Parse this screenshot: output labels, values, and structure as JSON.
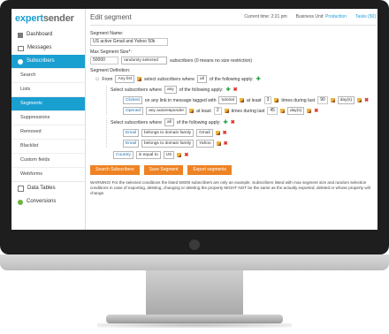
{
  "app": {
    "logo_left": "expert",
    "logo_right": "sender"
  },
  "nav": {
    "main": [
      {
        "label": "Dashboard",
        "active": false
      },
      {
        "label": "Messages",
        "active": false
      },
      {
        "label": "Subscribers",
        "active": true
      }
    ],
    "sub": [
      {
        "label": "Search",
        "active": false
      },
      {
        "label": "Lists",
        "active": false
      },
      {
        "label": "Segments",
        "active": true
      },
      {
        "label": "Suppressions",
        "active": false
      },
      {
        "label": "Removed",
        "active": false
      },
      {
        "label": "Blacklist",
        "active": false
      },
      {
        "label": "Custom fields",
        "active": false
      },
      {
        "label": "Webforms",
        "active": false
      }
    ],
    "bottom": [
      {
        "label": "Data Tables"
      },
      {
        "label": "Conversions"
      }
    ]
  },
  "header": {
    "title": "Edit segment",
    "time_label": "Current time: 2:21 pm",
    "business_label": "Business Unit:",
    "business_value": "Production",
    "tasks": "Tasks (50)"
  },
  "form": {
    "name_label": "Segment Name:",
    "name_value": "US active Gmail and Yahoo 50k",
    "max_label": "Max Segment Size*:",
    "max_value": "50000",
    "max_mode": "randomly selected",
    "max_hint": "subscribers (0 means no size restriction)",
    "def_label": "Segment Definition:"
  },
  "definition": {
    "from": "From",
    "any_list": "Any list",
    "select_where": "select subscribers where",
    "all": "all",
    "any": "any",
    "of_following": "of the following apply:",
    "select_subs_where": "Select subscribers where",
    "clicked": "Clicked",
    "on_any_link": "on any link in message tagged with",
    "tag": "tutorial",
    "at_least": "at least",
    "n3": "3",
    "times_during_last": "times during last",
    "n90": "90",
    "days": "day(s)",
    "opened": "Opened",
    "any_autoresponder": "any autoresponder",
    "n2": "2",
    "n45": "45",
    "email": "Email",
    "belongs": "belongs to domain family",
    "gmail": "Gmail",
    "yahoo": "Yahoo",
    "country": "Country",
    "is_equal": "is equal to",
    "us": "US"
  },
  "buttons": {
    "search": "Search Subscribers",
    "save": "Save Segment",
    "export": "Export segments"
  },
  "warning": "WARNING! For the selected conditions the listed 50000 subscribers are only an example. Subscribers listed with max segment size and random selection conditions in case of exporting, deleting, changing or deleting the property MIGHT NOT be the same as the actually exported, deleted or whose property will change.",
  "colors": {
    "accent": "#1a9fd1",
    "button": "#ee8324"
  }
}
